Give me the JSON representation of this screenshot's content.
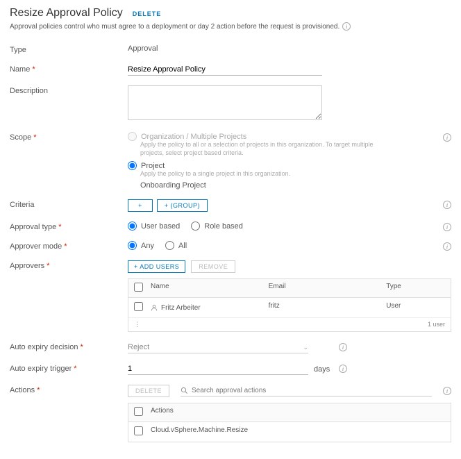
{
  "header": {
    "title": "Resize Approval Policy",
    "delete_label": "DELETE"
  },
  "subtitle": "Approval policies control who must agree to a deployment or day 2 action before the request is provisioned.",
  "labels": {
    "type": "Type",
    "name": "Name",
    "description": "Description",
    "scope": "Scope",
    "criteria": "Criteria",
    "approval_type": "Approval type",
    "approver_mode": "Approver mode",
    "approvers": "Approvers",
    "auto_expiry_decision": "Auto expiry decision",
    "auto_expiry_trigger": "Auto expiry trigger",
    "actions": "Actions"
  },
  "values": {
    "type": "Approval",
    "name": "Resize Approval Policy",
    "project_name": "Onboarding Project",
    "expiry_decision": "Reject",
    "expiry_trigger": "1",
    "days_label": "days"
  },
  "scope": {
    "org_label": "Organization / Multiple Projects",
    "org_hint": "Apply the policy to all or a selection of projects in this organization. To target multiple projects, select project based criteria.",
    "project_label": "Project",
    "project_hint": "Apply the policy to a single project in this organization."
  },
  "criteria": {
    "plus_label": "+",
    "group_label": "+ (GROUP)"
  },
  "approval_type": {
    "user_label": "User based",
    "role_label": "Role based"
  },
  "approver_mode": {
    "any_label": "Any",
    "all_label": "All"
  },
  "approvers": {
    "add_label": "+   ADD USERS",
    "remove_label": "REMOVE",
    "columns": {
      "name": "Name",
      "email": "Email",
      "type": "Type"
    },
    "rows": [
      {
        "name": "Fritz Arbeiter",
        "email": "fritz",
        "type": "User"
      }
    ],
    "footer_count": "1 user"
  },
  "actions": {
    "delete_label": "DELETE",
    "search_placeholder": "Search approval actions",
    "columns": {
      "actions": "Actions"
    },
    "rows": [
      {
        "action": "Cloud.vSphere.Machine.Resize"
      }
    ]
  }
}
